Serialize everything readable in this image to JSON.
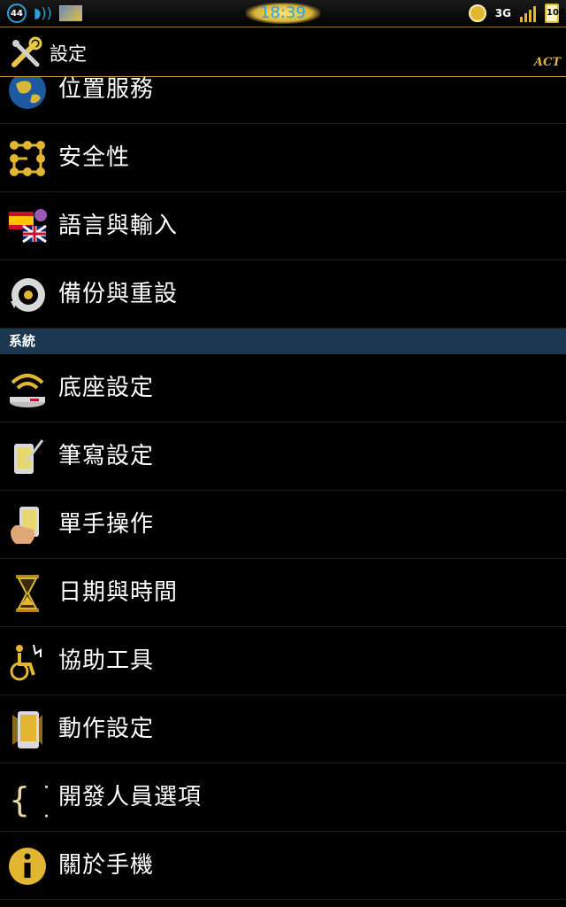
{
  "status_bar": {
    "notification_count": "44",
    "time": "18:39",
    "network": "3G",
    "battery": "100"
  },
  "action_bar": {
    "title": "設定",
    "watermark": "ACT"
  },
  "colors": {
    "accent_gold": "#d9b63a",
    "section_header_bg": "#1b3850",
    "background": "#000000"
  },
  "items_top": [
    {
      "label": "位置服務",
      "icon": "globe-icon"
    },
    {
      "label": "安全性",
      "icon": "pattern-lock-icon"
    },
    {
      "label": "語言與輸入",
      "icon": "flags-icon"
    },
    {
      "label": "備份與重設",
      "icon": "restore-icon"
    }
  ],
  "section": {
    "label": "系統"
  },
  "items_system": [
    {
      "label": "底座設定",
      "icon": "dock-icon"
    },
    {
      "label": "筆寫設定",
      "icon": "pen-phone-icon"
    },
    {
      "label": "單手操作",
      "icon": "hand-phone-icon"
    },
    {
      "label": "日期與時間",
      "icon": "hourglass-icon"
    },
    {
      "label": "協助工具",
      "icon": "accessibility-icon"
    },
    {
      "label": "動作設定",
      "icon": "motion-phone-icon"
    },
    {
      "label": "開發人員選項",
      "icon": "braces-icon"
    },
    {
      "label": "關於手機",
      "icon": "info-icon"
    }
  ]
}
